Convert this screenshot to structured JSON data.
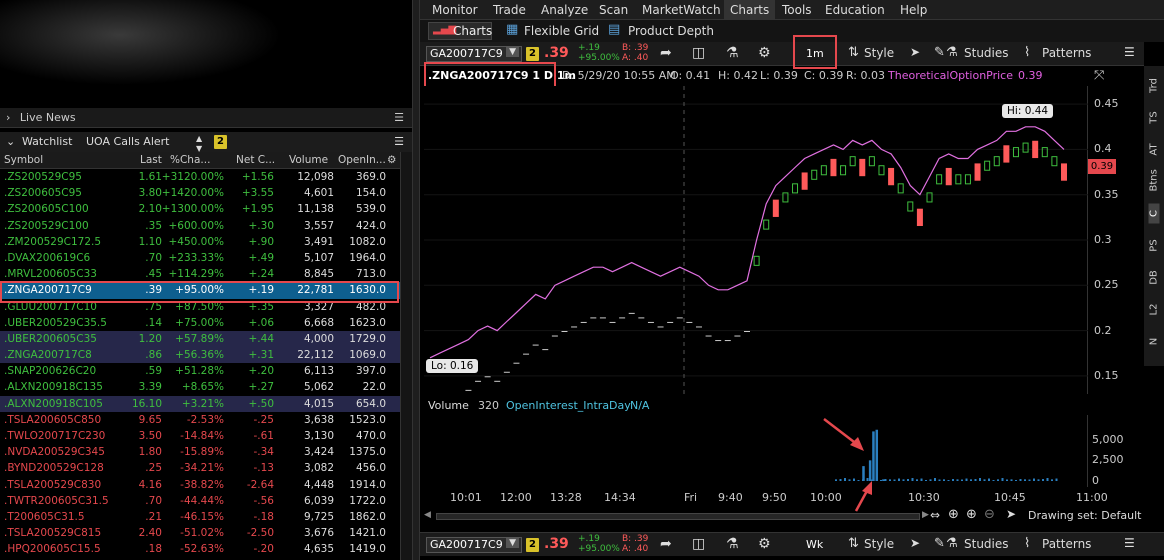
{
  "live_news": "Live News",
  "watchlist": {
    "title": "Watchlist",
    "name": "UOA Calls Alert",
    "badge": "2"
  },
  "columns": [
    "Symbol",
    "Last",
    "%Cha...",
    "Net C...",
    "Volume",
    "OpenIn..."
  ],
  "rows": [
    {
      "sym": ".ZS200529C95",
      "last": "1.61",
      "pct": "+3120.00%",
      "net": "+1.56",
      "vol": "12,098",
      "oi": "369.0",
      "dir": "up"
    },
    {
      "sym": ".ZS200605C95",
      "last": "3.80",
      "pct": "+1420.00%",
      "net": "+3.55",
      "vol": "4,601",
      "oi": "154.0",
      "dir": "up"
    },
    {
      "sym": ".ZS200605C100",
      "last": "2.10",
      "pct": "+1300.00%",
      "net": "+1.95",
      "vol": "11,138",
      "oi": "539.0",
      "dir": "up"
    },
    {
      "sym": ".ZS200529C100",
      "last": ".35",
      "pct": "+600.00%",
      "net": "+.30",
      "vol": "3,557",
      "oi": "424.0",
      "dir": "up"
    },
    {
      "sym": ".ZM200529C172.5",
      "last": "1.10",
      "pct": "+450.00%",
      "net": "+.90",
      "vol": "3,491",
      "oi": "1082.0",
      "dir": "up"
    },
    {
      "sym": ".DVAX200619C6",
      "last": ".70",
      "pct": "+233.33%",
      "net": "+.49",
      "vol": "5,107",
      "oi": "1964.0",
      "dir": "up"
    },
    {
      "sym": ".MRVL200605C33",
      "last": ".45",
      "pct": "+114.29%",
      "net": "+.24",
      "vol": "8,845",
      "oi": "713.0",
      "dir": "up"
    },
    {
      "sym": ".ZNGA200717C9",
      "last": ".39",
      "pct": "+95.00%",
      "net": "+.19",
      "vol": "22,781",
      "oi": "1630.0",
      "dir": "sel"
    },
    {
      "sym": ".GLUU200717C10",
      "last": ".75",
      "pct": "+87.50%",
      "net": "+.35",
      "vol": "3,327",
      "oi": "482.0",
      "dir": "up"
    },
    {
      "sym": ".UBER200529C35.5",
      "last": ".14",
      "pct": "+75.00%",
      "net": "+.06",
      "vol": "6,668",
      "oi": "1623.0",
      "dir": "up"
    },
    {
      "sym": ".UBER200605C35",
      "last": "1.20",
      "pct": "+57.89%",
      "net": "+.44",
      "vol": "4,000",
      "oi": "1729.0",
      "dir": "hl"
    },
    {
      "sym": ".ZNGA200717C8",
      "last": ".86",
      "pct": "+56.36%",
      "net": "+.31",
      "vol": "22,112",
      "oi": "1069.0",
      "dir": "hl"
    },
    {
      "sym": ".SNAP200626C20",
      "last": ".59",
      "pct": "+51.28%",
      "net": "+.20",
      "vol": "6,113",
      "oi": "397.0",
      "dir": "up"
    },
    {
      "sym": ".ALXN200918C135",
      "last": "3.39",
      "pct": "+8.65%",
      "net": "+.27",
      "vol": "5,062",
      "oi": "22.0",
      "dir": "up"
    },
    {
      "sym": ".ALXN200918C105",
      "last": "16.10",
      "pct": "+3.21%",
      "net": "+.50",
      "vol": "4,015",
      "oi": "654.0",
      "dir": "hl"
    },
    {
      "sym": ".TSLA200605C850",
      "last": "9.65",
      "pct": "-2.53%",
      "net": "-.25",
      "vol": "3,638",
      "oi": "1523.0",
      "dir": "down"
    },
    {
      "sym": ".TWLO200717C230",
      "last": "3.50",
      "pct": "-14.84%",
      "net": "-.61",
      "vol": "3,130",
      "oi": "470.0",
      "dir": "down"
    },
    {
      "sym": ".NVDA200529C345",
      "last": "1.80",
      "pct": "-15.89%",
      "net": "-.34",
      "vol": "3,424",
      "oi": "1375.0",
      "dir": "down"
    },
    {
      "sym": ".BYND200529C128",
      "last": ".25",
      "pct": "-34.21%",
      "net": "-.13",
      "vol": "3,082",
      "oi": "456.0",
      "dir": "down"
    },
    {
      "sym": ".TSLA200529C830",
      "last": "4.16",
      "pct": "-38.82%",
      "net": "-2.64",
      "vol": "4,448",
      "oi": "1914.0",
      "dir": "down"
    },
    {
      "sym": ".TWTR200605C31.5",
      "last": ".70",
      "pct": "-44.44%",
      "net": "-.56",
      "vol": "6,039",
      "oi": "1722.0",
      "dir": "down"
    },
    {
      "sym": ".T200605C31.5",
      "last": ".21",
      "pct": "-46.15%",
      "net": "-.18",
      "vol": "9,725",
      "oi": "1862.0",
      "dir": "down"
    },
    {
      "sym": ".TSLA200529C815",
      "last": "2.40",
      "pct": "-51.02%",
      "net": "-2.50",
      "vol": "3,676",
      "oi": "1421.0",
      "dir": "down"
    },
    {
      "sym": ".HPQ200605C15.5",
      "last": ".18",
      "pct": "-52.63%",
      "net": "-.20",
      "vol": "4,635",
      "oi": "1419.0",
      "dir": "down"
    }
  ],
  "menu": [
    "Monitor",
    "Trade",
    "Analyze",
    "Scan",
    "MarketWatch",
    "Charts",
    "Tools",
    "Education",
    "Help"
  ],
  "subtabs": [
    "Charts",
    "Flexible Grid",
    "Product Depth"
  ],
  "toolbar": {
    "symbol": "GA200717C9",
    "link": "2",
    "price": ".39",
    "chg1": "+.19",
    "chg2": "+95.00%",
    "bid": "B: .39",
    "ask": "A: .40",
    "interval": "1m",
    "style": "Style",
    "studies": "Studies",
    "patterns": "Patterns"
  },
  "info": {
    "title": ".ZNGA200717C9 1 D 1m",
    "d": "D: 5/29/20 10:55 AM",
    "o": "O: 0.41",
    "h": "H: 0.42",
    "l": "L: 0.39",
    "c": "C: 0.39",
    "r": "R: 0.03",
    "study": "TheoreticalOptionPrice",
    "study_val": "0.39"
  },
  "price_axis": [
    "0.45",
    "0.4",
    "0.35",
    "0.3",
    "0.25",
    "0.2",
    "0.15"
  ],
  "price_tag": "0.39",
  "hi_label": "Hi: 0.44",
  "lo_label": "Lo: 0.16",
  "volume": {
    "label": "Volume",
    "value": "320",
    "oi": "OpenInterest_IntraDay",
    "na": "N/A",
    "axis": [
      "5,000",
      "2,500",
      "0"
    ]
  },
  "time_axis": [
    "10:01",
    "12:00",
    "13:28",
    "14:34",
    "Fri",
    "9:40",
    "9:50",
    "10:00",
    "10:30",
    "10:45",
    "11:00"
  ],
  "side_tabs": [
    "Trd",
    "TS",
    "AT",
    "Btns",
    "C",
    "PS",
    "DB",
    "L2",
    "N"
  ],
  "drawing_set": "Drawing set: Default",
  "toolbar2": {
    "symbol": "GA200717C9",
    "link": "2",
    "price": ".39",
    "chg1": "+.19",
    "chg2": "+95.00%",
    "bid": "B: .39",
    "ask": "A: .40",
    "interval": "Wk",
    "style": "Style",
    "studies": "Studies",
    "patterns": "Patterns"
  },
  "chart_data": {
    "type": "candlestick",
    "title": ".ZNGA200717C9 1 D 1m",
    "ylim": [
      0.13,
      0.47
    ],
    "price_line": [
      0.17,
      0.175,
      0.18,
      0.185,
      0.19,
      0.2,
      0.205,
      0.2,
      0.21,
      0.22,
      0.23,
      0.24,
      0.235,
      0.25,
      0.255,
      0.26,
      0.265,
      0.27,
      0.27,
      0.265,
      0.27,
      0.275,
      0.27,
      0.265,
      0.26,
      0.265,
      0.27,
      0.265,
      0.26,
      0.25,
      0.245,
      0.245,
      0.25,
      0.255,
      0.3,
      0.34,
      0.36,
      0.37,
      0.38,
      0.39,
      0.395,
      0.4,
      0.405,
      0.4,
      0.41,
      0.405,
      0.41,
      0.4,
      0.395,
      0.38,
      0.36,
      0.35,
      0.37,
      0.39,
      0.395,
      0.39,
      0.39,
      0.4,
      0.405,
      0.41,
      0.42,
      0.42,
      0.425,
      0.425,
      0.42,
      0.41,
      0.4
    ],
    "hi": 0.44,
    "lo": 0.16,
    "last": 0.39,
    "volume_bars": [
      [
        0.66,
        1800
      ],
      [
        0.67,
        2500
      ],
      [
        0.675,
        6000
      ],
      [
        0.68,
        6200
      ],
      [
        0.69,
        200
      ]
    ]
  }
}
